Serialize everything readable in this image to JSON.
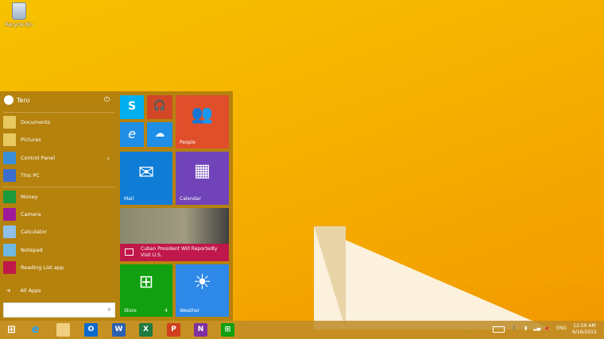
{
  "desktop": {
    "recycle_bin": "Recycle Bin"
  },
  "start_menu": {
    "user": "Tero",
    "places": [
      {
        "label": "Documents",
        "icon": "folder-icon",
        "color": "#e8c860"
      },
      {
        "label": "Pictures",
        "icon": "pictures-folder-icon",
        "color": "#e8c860"
      },
      {
        "label": "Control Panel",
        "icon": "control-panel-icon",
        "color": "#3a8fd8",
        "submenu": true
      },
      {
        "label": "This PC",
        "icon": "computer-icon",
        "color": "#3a6fd0"
      }
    ],
    "apps": [
      {
        "label": "Money",
        "icon": "money-icon",
        "color": "#1a9a3a"
      },
      {
        "label": "Camera",
        "icon": "camera-icon",
        "color": "#a0189a"
      },
      {
        "label": "Calculator",
        "icon": "calculator-icon",
        "color": "#8fc0e8"
      },
      {
        "label": "Notepad",
        "icon": "notepad-icon",
        "color": "#6fb8e0"
      },
      {
        "label": "Reading List app",
        "icon": "reading-list-icon",
        "color": "#c01848"
      }
    ],
    "all_apps": "All Apps",
    "search_placeholder": ""
  },
  "tiles": {
    "people": "People",
    "mail": "Mail",
    "calendar": "Calendar",
    "news": "Cuban President Will Reportedly Visit U.S.",
    "store": "Store",
    "store_badge": "4",
    "weather": "Weather"
  },
  "taskbar": {
    "apps": [
      "Start",
      "Internet Explorer",
      "File Explorer",
      "Outlook",
      "Word",
      "Excel",
      "PowerPoint",
      "OneNote",
      "Store"
    ],
    "language": "ENG",
    "time": "12:59 AM",
    "date": "9/16/2015"
  }
}
